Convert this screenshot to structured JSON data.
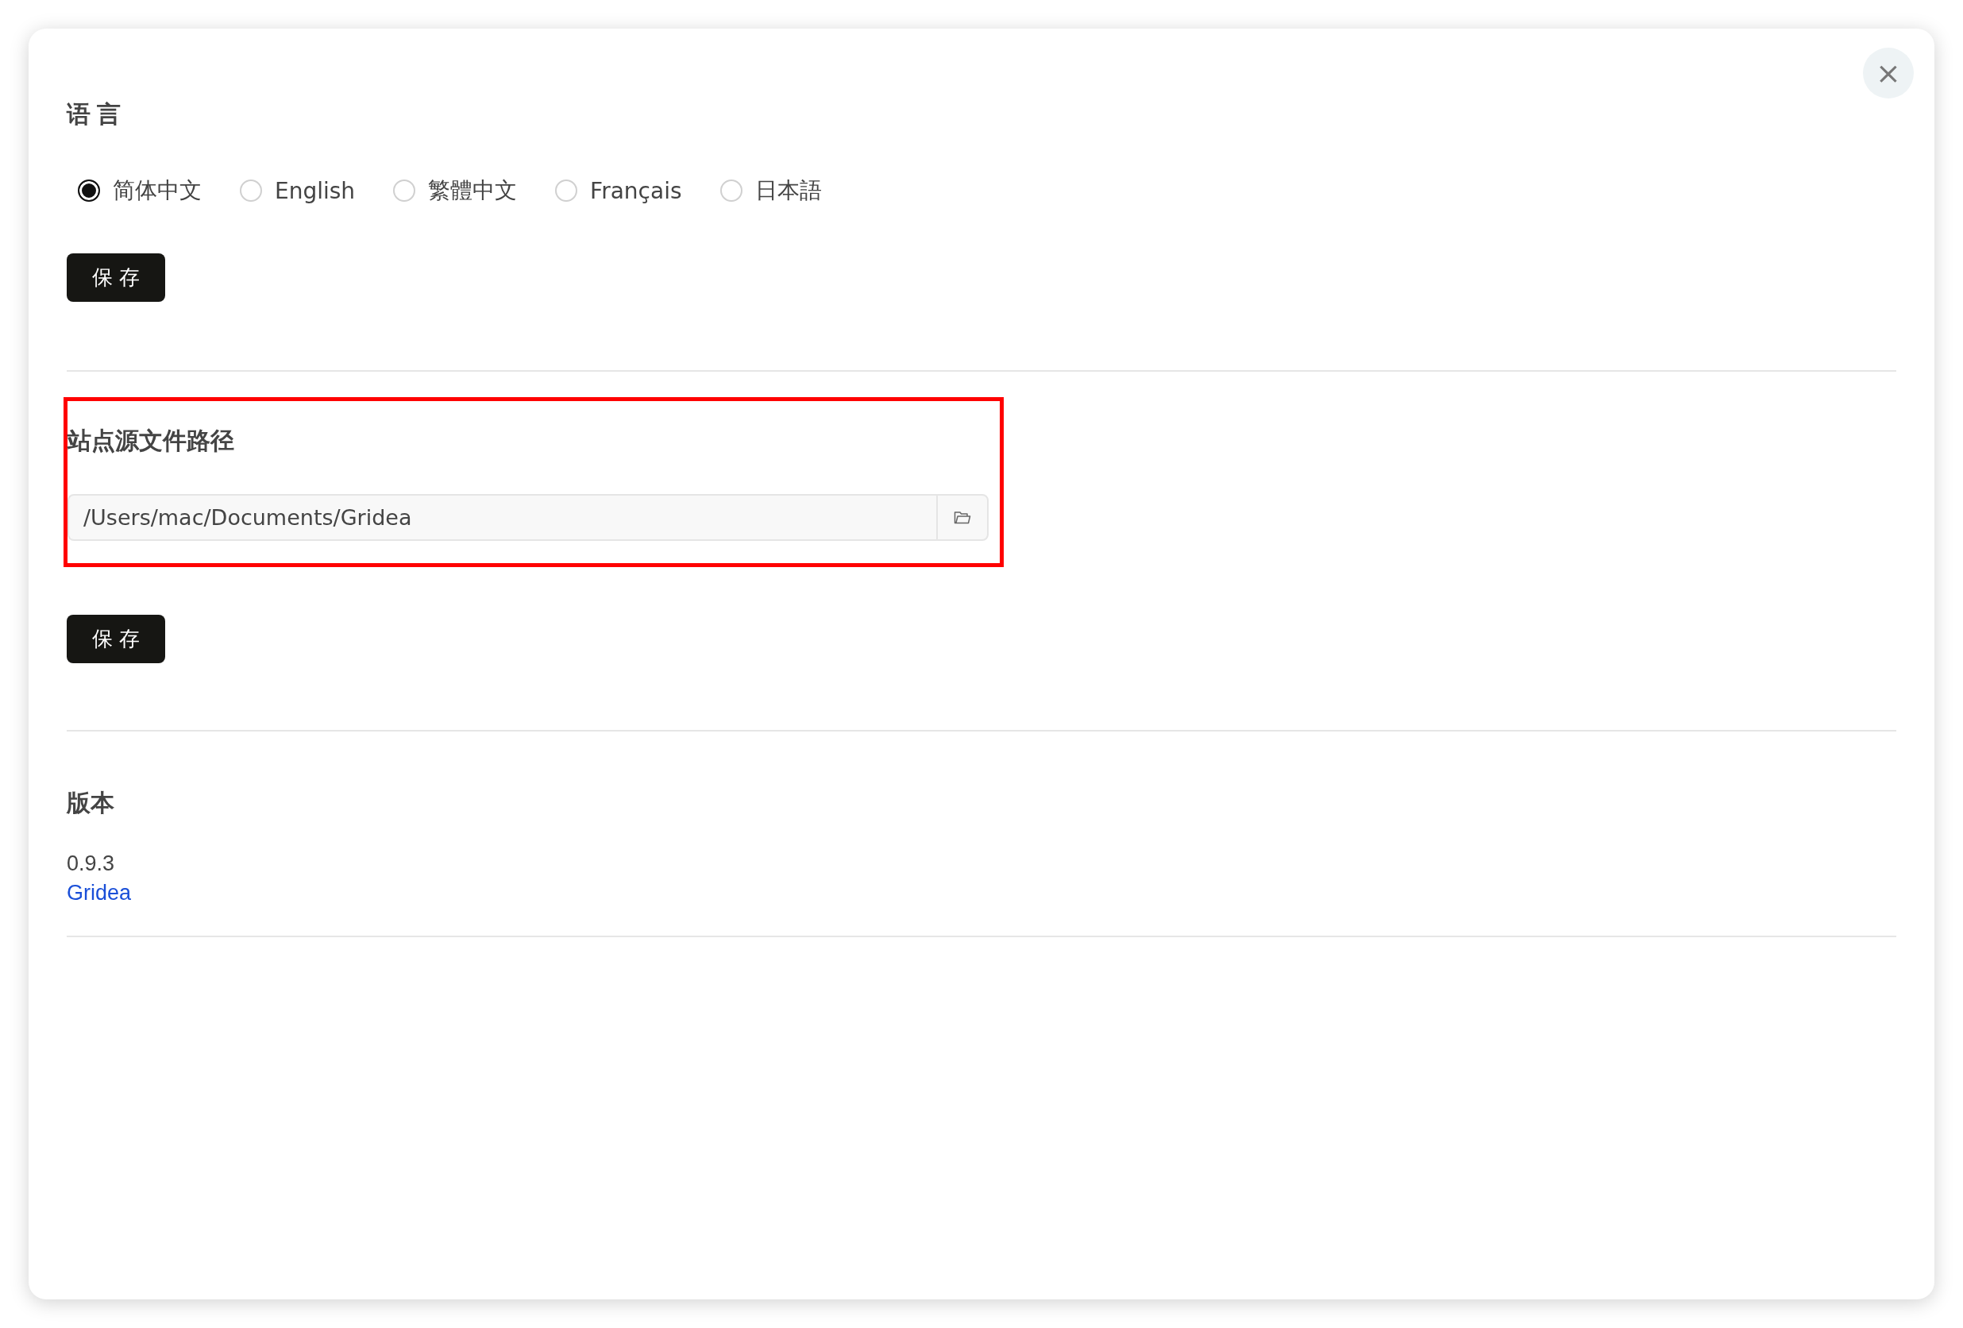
{
  "close_button": {
    "label": "×"
  },
  "language": {
    "title": "语 言",
    "options": [
      {
        "label": "简体中文",
        "selected": true
      },
      {
        "label": "English",
        "selected": false
      },
      {
        "label": "繁體中文",
        "selected": false
      },
      {
        "label": "Français",
        "selected": false
      },
      {
        "label": "日本語",
        "selected": false
      }
    ],
    "save_button": "保 存"
  },
  "source_path": {
    "title": "站点源文件路径",
    "highlighted": true,
    "value": "/Users/mac/Documents/Gridea",
    "save_button": "保 存"
  },
  "version": {
    "title": "版本",
    "number": "0.9.3",
    "link": "Gridea"
  }
}
